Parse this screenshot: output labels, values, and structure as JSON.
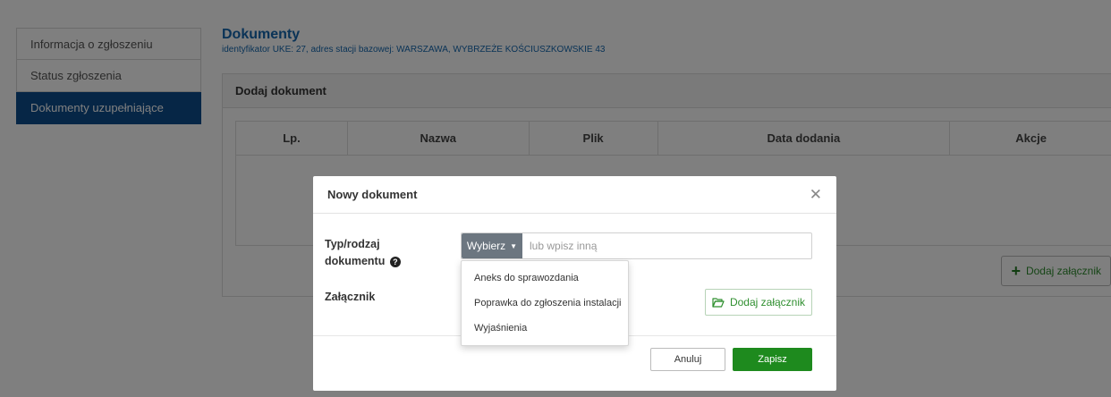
{
  "colors": {
    "brand_blue": "#0d4c8c",
    "title_blue": "#1467ae",
    "success_green": "#1e8a1e",
    "overlay": "rgba(0,0,0,0.5)"
  },
  "sidebar": {
    "items": [
      {
        "label": "Informacja o zgłoszeniu",
        "active": false
      },
      {
        "label": "Status zgłoszenia",
        "active": false
      },
      {
        "label": "Dokumenty uzupełniające",
        "active": true
      }
    ]
  },
  "header": {
    "title": "Dokumenty",
    "subtitle": "identyfikator UKE: 27, adres stacji bazowej: WARSZAWA, WYBRZEŻE KOŚCIUSZKOWSKIE 43"
  },
  "panel": {
    "title": "Dodaj dokument",
    "table": {
      "columns": [
        "Lp.",
        "Nazwa",
        "Plik",
        "Data dodania",
        "Akcje"
      ],
      "rows": []
    },
    "add_attachment_label": "Dodaj załącznik",
    "add_attachment_icon": "plus-icon"
  },
  "modal": {
    "title": "Nowy dokument",
    "close_icon": "close-icon",
    "type_label_line1": "Typ/rodzaj",
    "type_label_line2": "dokumentu",
    "help_icon": "question-circle-icon",
    "dropdown_label": "Wybierz",
    "type_placeholder": "lub wpisz inną",
    "dropdown_options": [
      "Aneks do sprawozdania",
      "Poprawka do zgłoszenia instalacji",
      "Wyjaśnienia"
    ],
    "attachment_label": "Załącznik",
    "attach_button_label": "Dodaj załącznik",
    "attach_button_icon": "folder-open-icon",
    "cancel_label": "Anuluj",
    "save_label": "Zapisz"
  }
}
